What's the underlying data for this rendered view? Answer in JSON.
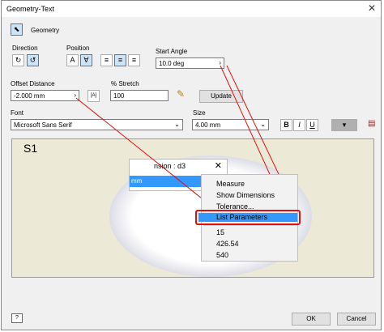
{
  "window": {
    "title": "Geometry-Text",
    "close_glyph": "✕"
  },
  "toolbar": {
    "geometry_label": "Geometry"
  },
  "direction": {
    "label": "Direction"
  },
  "position": {
    "label": "Position"
  },
  "start_angle": {
    "label": "Start Angle",
    "value": "10.0 deg"
  },
  "offset": {
    "label": "Offset Distance",
    "value": "-2.000 mm"
  },
  "stretch": {
    "label": "% Stretch",
    "value": "100"
  },
  "update_button": "Update",
  "font": {
    "label": "Font",
    "value": "Microsoft Sans Serif"
  },
  "size": {
    "label": "Size",
    "value": "4.00 mm"
  },
  "style_buttons": {
    "bold": "B",
    "italic": "I",
    "underline": "U"
  },
  "preview": {
    "text": "S1"
  },
  "dimension_popup": {
    "title": "nsion : d3",
    "field": "mm",
    "close_glyph": "✕"
  },
  "context_menu": {
    "items": [
      "Measure",
      "Show Dimensions",
      "Tolerance...",
      "List Parameters",
      "15",
      "426.54",
      "540"
    ],
    "highlighted": "List Parameters"
  },
  "footer": {
    "ok": "OK",
    "cancel": "Cancel"
  },
  "colors": {
    "highlight": "#3399ff",
    "callout": "#e01010",
    "preview_bg": "#ecead7"
  },
  "icons": [
    "select-arrow-icon",
    "pencil-icon",
    "color-swatch-icon",
    "help-icon"
  ]
}
